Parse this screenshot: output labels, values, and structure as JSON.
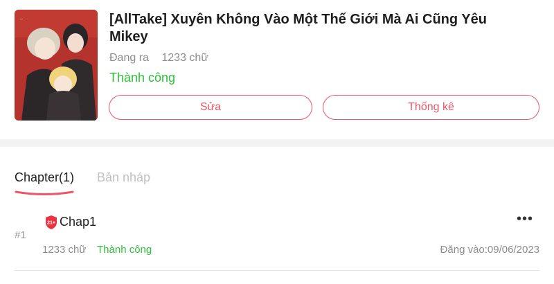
{
  "story": {
    "title": "[AllTake] Xuyên Không Vào Một Thế Giới Mà Ai Cũng Yêu Mikey",
    "state": "Đang ra",
    "word_count": "1233 chữ",
    "status": "Thành công",
    "cover_icon": "cover-image"
  },
  "actions": {
    "edit_label": "Sửa",
    "stats_label": "Thống kê"
  },
  "tabs": [
    {
      "label": "Chapter(1)",
      "active": true
    },
    {
      "label": "Bản nháp",
      "active": false
    }
  ],
  "chapters": [
    {
      "index": "#1",
      "badge": "21+",
      "title": "Chap1",
      "word_count": "1233 chữ",
      "status": "Thành công",
      "date": "Đăng vào:09/06/2023",
      "more_icon": "more-dots-icon"
    }
  ],
  "colors": {
    "accent": "#ee5566",
    "success": "#2ec03a",
    "muted": "#8c8c8c",
    "cover_bg": "#b5332d"
  }
}
